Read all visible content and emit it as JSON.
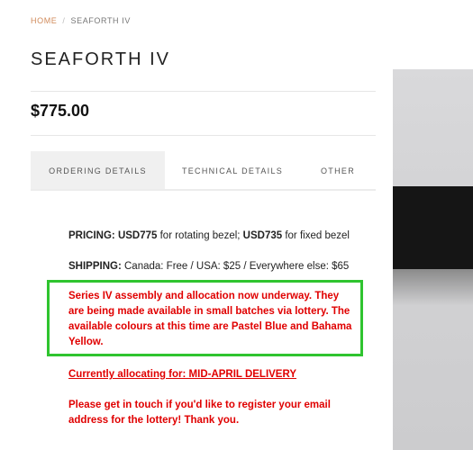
{
  "breadcrumb": {
    "home": "HOME",
    "separator": "/",
    "current": "SEAFORTH IV"
  },
  "product": {
    "title": "SEAFORTH IV",
    "price": "$775.00"
  },
  "tabs": [
    {
      "label": "ORDERING DETAILS",
      "active": true
    },
    {
      "label": "TECHNICAL DETAILS",
      "active": false
    },
    {
      "label": "OTHER",
      "active": false
    }
  ],
  "details": {
    "pricing_label": "PRICING:",
    "pricing_rotating_price": "USD775",
    "pricing_rotating_text": " for rotating bezel; ",
    "pricing_fixed_price": "USD735",
    "pricing_fixed_text": " for fixed bezel",
    "shipping_label": "SHIPPING:",
    "shipping_text": " Canada: Free / USA: $25 / Everywhere else: $65",
    "series_notice": "Series IV assembly and allocation now underway. They are being made available in small batches via lottery. The available colours at this time are Pastel Blue and Bahama Yellow.",
    "allocating_link": "Currently allocating for: MID-APRIL DELIVERY",
    "contact_text": "Please get in touch if you'd like to register your email address for the lottery! Thank you."
  },
  "colors": {
    "notice_red": "#e00000",
    "highlight_green": "#2fc42f",
    "breadcrumb_home": "#d08a5a"
  }
}
